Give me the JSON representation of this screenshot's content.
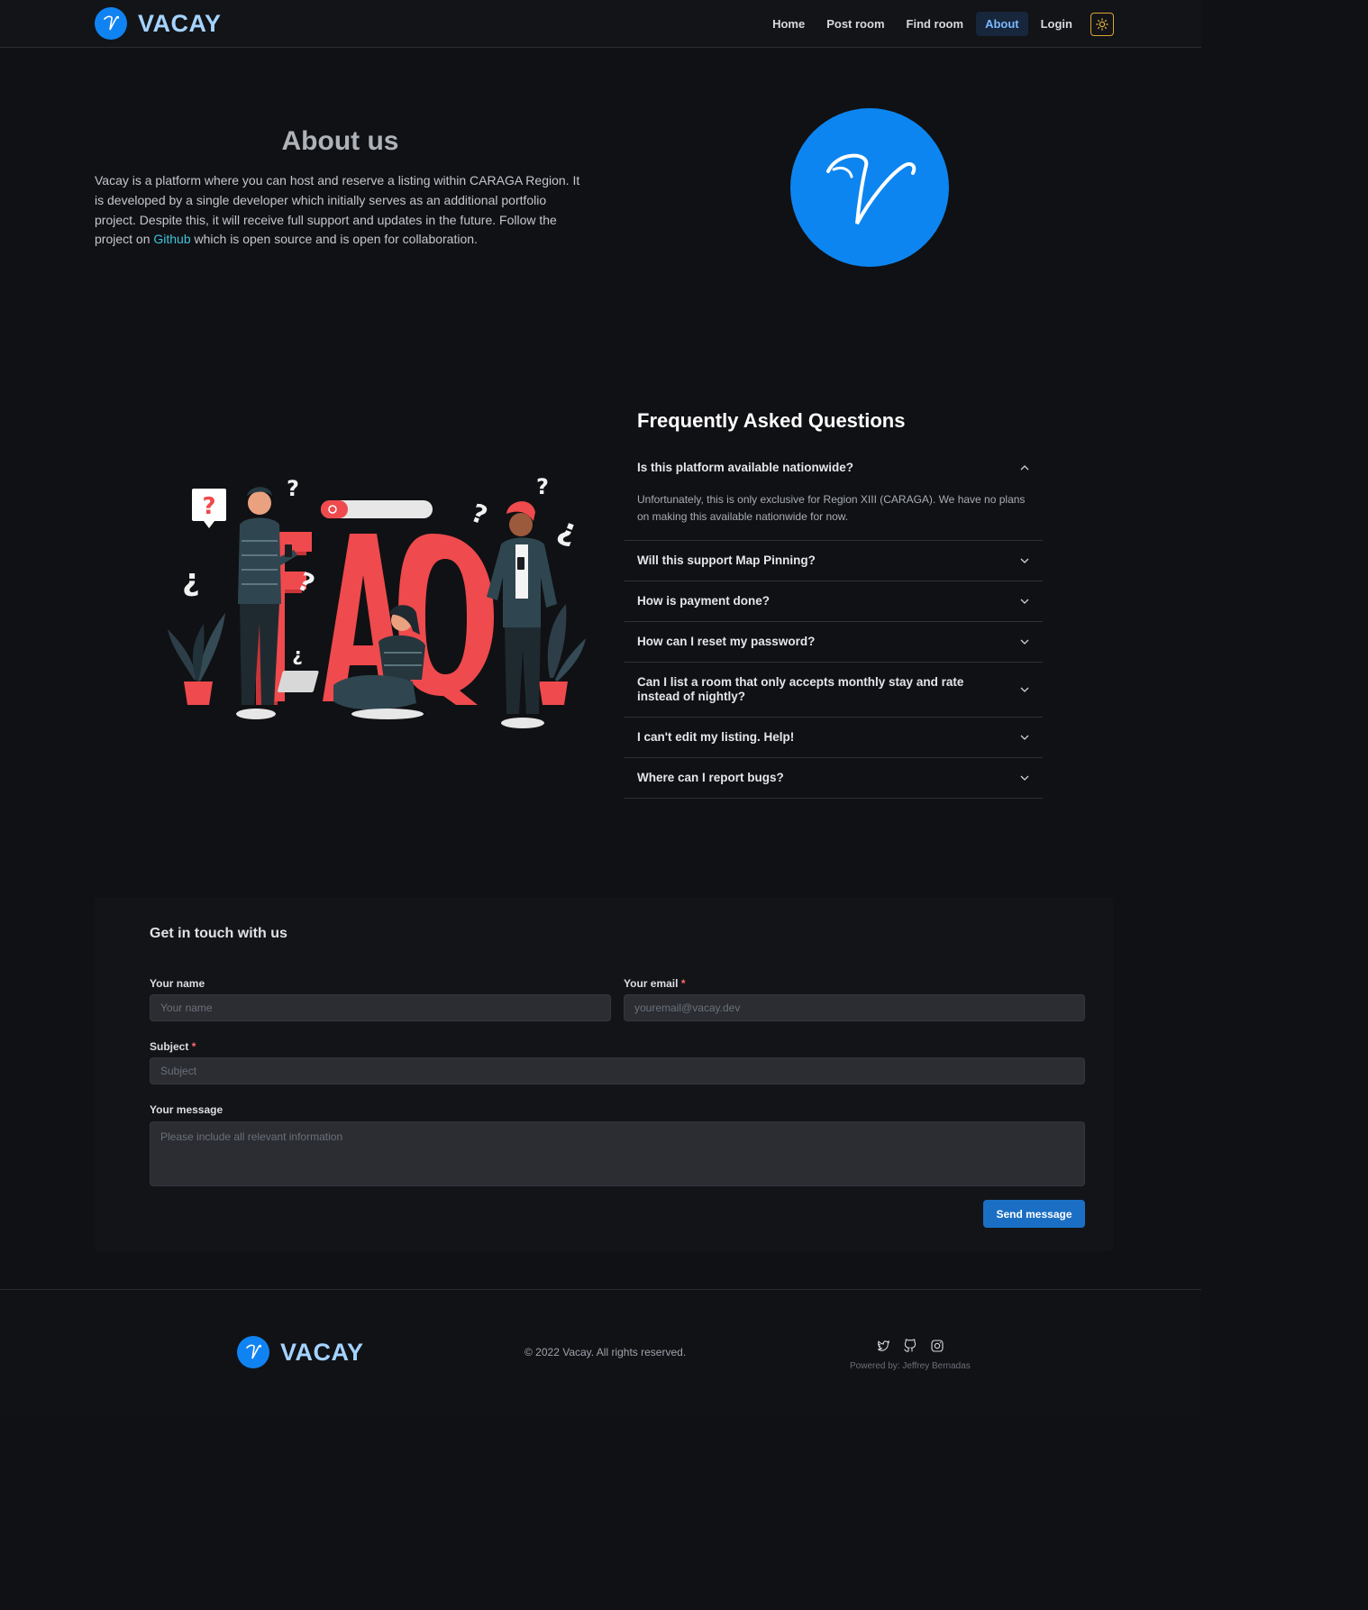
{
  "header": {
    "brand": "VACAY",
    "nav": [
      "Home",
      "Post room",
      "Find room",
      "About",
      "Login"
    ],
    "active": "About",
    "theme_icon": "sun-icon"
  },
  "about": {
    "title": "About us",
    "text_before_link": "Vacay is a platform where you can host and reserve a listing within CARAGA Region. It is developed by a single developer which initially serves as an additional portfolio project. Despite this, it will receive full support and updates in the future. Follow the project on ",
    "link_text": "Github",
    "text_after_link": " which is open source and is open for collaboration."
  },
  "faq": {
    "title": "Frequently Asked Questions",
    "items": [
      {
        "q": "Is this platform available nationwide?",
        "a": "Unfortunately, this is only exclusive for Region XIII (CARAGA). We have no plans on making this available nationwide for now."
      },
      {
        "q": "Will this support Map Pinning?"
      },
      {
        "q": "How is payment done?"
      },
      {
        "q": "How can I reset my password?"
      },
      {
        "q": "Can I list a room that only accepts monthly stay and rate instead of nightly?"
      },
      {
        "q": "I can't edit my listing. Help!"
      },
      {
        "q": "Where can I report bugs?"
      }
    ]
  },
  "contact": {
    "title": "Get in touch with us",
    "name_label": "Your name",
    "name_placeholder": "Your name",
    "email_label": "Your email",
    "email_placeholder": "youremail@vacay.dev",
    "subject_label": "Subject",
    "subject_placeholder": "Subject",
    "message_label": "Your message",
    "message_placeholder": "Please include all relevant information",
    "required_mark": "*",
    "send_label": "Send message"
  },
  "footer": {
    "brand": "VACAY",
    "copyright": "© 2022 Vacay. All rights reserved.",
    "powered": "Powered by: Jeffrey Bernadas",
    "social_icons": [
      "twitter-icon",
      "github-icon",
      "instagram-icon"
    ]
  },
  "colors": {
    "background": "#101114",
    "accent": "#1083f2",
    "brand_text": "#a5d3ff",
    "link": "#3fc4da",
    "faq_red": "#ef4a4d"
  }
}
